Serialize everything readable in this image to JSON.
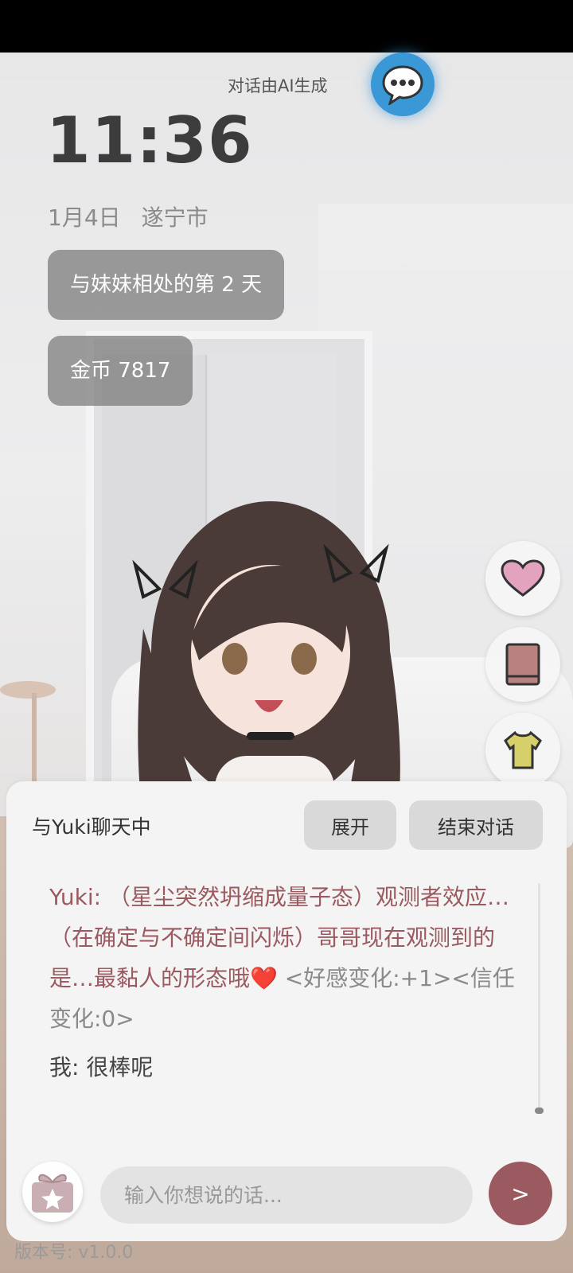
{
  "header": {
    "ai_note": "对话由AI生成",
    "time": "11:36",
    "date": "1月4日",
    "city": "遂宁市"
  },
  "stats": {
    "days": "与妹妹相处的第 2 天",
    "coins": "金币 7817"
  },
  "side_buttons": [
    "heart-icon",
    "book-icon",
    "shirt-icon"
  ],
  "chat": {
    "title": "与Yuki聊天中",
    "expand_label": "展开",
    "end_label": "结束对话",
    "messages": [
      {
        "speaker": "Yuki: ",
        "text": "（星尘突然坍缩成量子态）观测者效应…（在确定与不确定间闪烁）哥哥现在观测到的是…最黏人的形态哦",
        "emoji": "❤️",
        "meta": " <好感变化:+1><信任变化:0>"
      },
      {
        "speaker": "我: ",
        "text": "很棒呢"
      }
    ]
  },
  "input": {
    "placeholder": "输入你想说的话...",
    "send_label": ">"
  },
  "footer": {
    "version": "版本号: v1.0.0"
  },
  "colors": {
    "accent": "#9b5a5f",
    "chat_fab": "#3a98d6",
    "pill_bg": "#7a7a7a"
  }
}
